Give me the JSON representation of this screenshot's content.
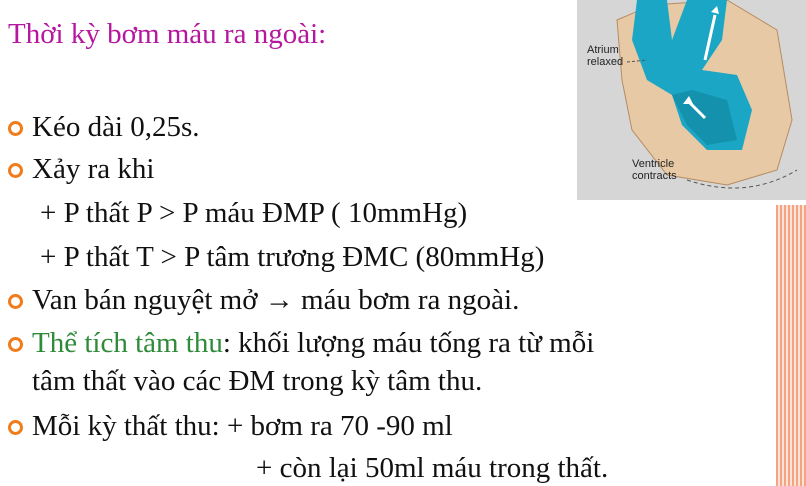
{
  "title": "Thời kỳ bơm máu ra ngoài:",
  "bullets": {
    "b1": "Kéo dài 0,25s.",
    "b2": "Xảy ra khi",
    "b2_sub1": "+ P thất P > P máu ĐMP ( 10mmHg)",
    "b2_sub2": "+ P thất T > P tâm trương ĐMC (80mmHg)",
    "b3": "Van bán nguyệt mở → máu bơm ra ngoài.",
    "b4_term": "Thể tích tâm thu",
    "b4_rest": ": khối lượng máu tống ra từ mỗi",
    "b4_line2": "tâm thất vào các ĐM trong kỳ tâm thu.",
    "b5": "Mỗi kỳ thất thu: + bơm ra 70 -90 ml",
    "b5_line2": "+ còn lại 50ml máu trong thất."
  },
  "figure": {
    "atrium_label_1": "Atrium",
    "atrium_label_2": "relaxed",
    "ventricle_label_1": "Ventricle",
    "ventricle_label_2": "contracts"
  },
  "colors": {
    "title": "#b5179e",
    "bullet": "#f07c1b",
    "term": "#2e8b3a",
    "blood": "#1aa6c4"
  }
}
